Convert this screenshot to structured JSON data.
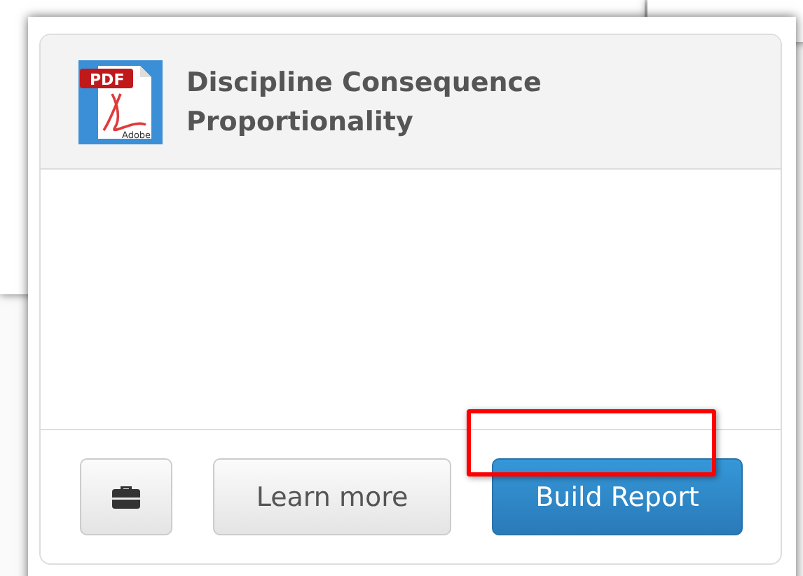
{
  "card": {
    "icon": {
      "tab_text": "PDF",
      "brand_text": "Adobe"
    },
    "title": "Discipline Consequence Proportionality"
  },
  "buttons": [
    {
      "kind": "icon"
    },
    {
      "kind": "default",
      "label": "Learn more"
    },
    {
      "kind": "primary",
      "label": "Build Report"
    }
  ]
}
